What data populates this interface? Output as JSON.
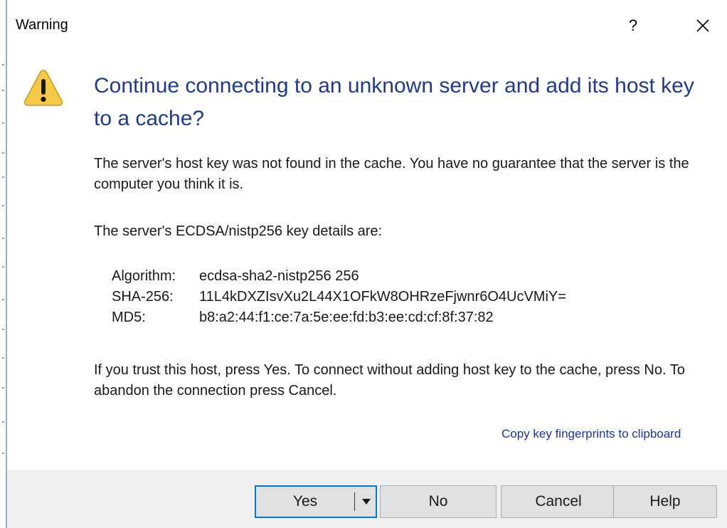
{
  "window": {
    "title": "Warning",
    "help_glyph": "?",
    "close_icon": "close-icon"
  },
  "icon": "warning-icon",
  "colors": {
    "heading": "#1e3b8f",
    "link": "#1a33a8",
    "accent": "#0078d7",
    "warning_fill": "#f7c948",
    "footer_bg": "#f0f0f0"
  },
  "content": {
    "heading": "Continue connecting to an unknown server and add its host key to a cache?",
    "paragraph1": "The server's host key was not found in the cache. You have no guarantee that the server is the computer you think it is.",
    "paragraph2": "The server's ECDSA/nistp256 key details are:",
    "details": [
      {
        "label": "Algorithm:",
        "value": "ecdsa-sha2-nistp256 256"
      },
      {
        "label": "SHA-256:",
        "value": "11L4kDXZIsvXu2L44X1OFkW8OHRzeFjwnr6O4UcVMiY="
      },
      {
        "label": "MD5:",
        "value": "b8:a2:44:f1:ce:7a:5e:ee:fd:b3:ee:cd:cf:8f:37:82"
      }
    ],
    "paragraph3": "If you trust this host, press Yes. To connect without adding host key to the cache, press No. To abandon the connection press Cancel.",
    "copy_link": "Copy key fingerprints to clipboard"
  },
  "buttons": {
    "yes": "Yes",
    "no": "No",
    "cancel": "Cancel",
    "help": "Help"
  }
}
